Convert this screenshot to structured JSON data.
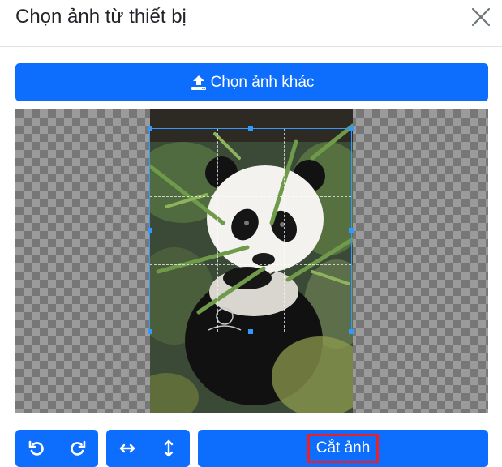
{
  "dialog": {
    "title": "Chọn ảnh từ thiết bị",
    "close_icon": "close-icon"
  },
  "upload": {
    "label": "Chọn ảnh khác",
    "icon": "upload-icon"
  },
  "toolbar": {
    "rotate_left_icon": "rotate-left-icon",
    "rotate_right_icon": "rotate-right-icon",
    "flip_horizontal_icon": "flip-horizontal-icon",
    "flip_vertical_icon": "flip-vertical-icon",
    "crop_label": "Cắt ảnh"
  },
  "colors": {
    "primary": "#0d6efd",
    "crop_outline": "#3399ff",
    "highlight": "#e8202a"
  }
}
